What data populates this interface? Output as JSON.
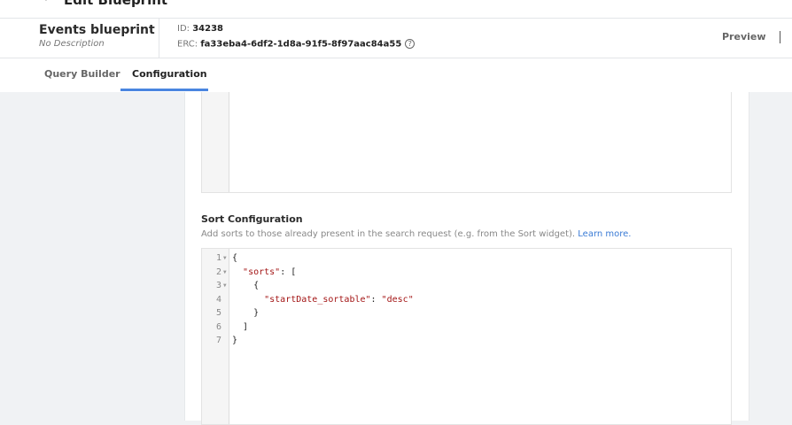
{
  "topbar": {
    "back_icon": "chevron-left-icon",
    "title": "Edit Blueprint"
  },
  "blueprint": {
    "name": "Events blueprint",
    "description": "No Description",
    "id_label": "ID:",
    "id": "34238",
    "erc_label": "ERC:",
    "erc": "fa33eba4-6df2-1d8a-91f5-8f97aac84a55",
    "help_icon": "question-circle-icon"
  },
  "actions": {
    "preview": "Preview"
  },
  "tabs": [
    {
      "label": "Query Builder",
      "active": false
    },
    {
      "label": "Configuration",
      "active": true
    }
  ],
  "sort": {
    "title": "Sort Configuration",
    "description": "Add sorts to those already present in the search request (e.g. from the Sort widget).",
    "learn_more": "Learn more.",
    "lines": [
      {
        "n": "1",
        "fold": true,
        "indent": "",
        "parts": [
          {
            "t": "{",
            "s": false
          }
        ]
      },
      {
        "n": "2",
        "fold": true,
        "indent": "  ",
        "parts": [
          {
            "t": "\"sorts\"",
            "s": true
          },
          {
            "t": ": [",
            "s": false
          }
        ]
      },
      {
        "n": "3",
        "fold": true,
        "indent": "    ",
        "parts": [
          {
            "t": "{",
            "s": false
          }
        ]
      },
      {
        "n": "4",
        "fold": false,
        "indent": "      ",
        "parts": [
          {
            "t": "\"startDate_sortable\"",
            "s": true
          },
          {
            "t": ": ",
            "s": false
          },
          {
            "t": "\"desc\"",
            "s": true
          }
        ]
      },
      {
        "n": "5",
        "fold": false,
        "indent": "    ",
        "parts": [
          {
            "t": "}",
            "s": false
          }
        ]
      },
      {
        "n": "6",
        "fold": false,
        "indent": "  ",
        "parts": [
          {
            "t": "]",
            "s": false
          }
        ]
      },
      {
        "n": "7",
        "fold": false,
        "indent": "",
        "parts": [
          {
            "t": "}",
            "s": false
          }
        ]
      }
    ]
  }
}
